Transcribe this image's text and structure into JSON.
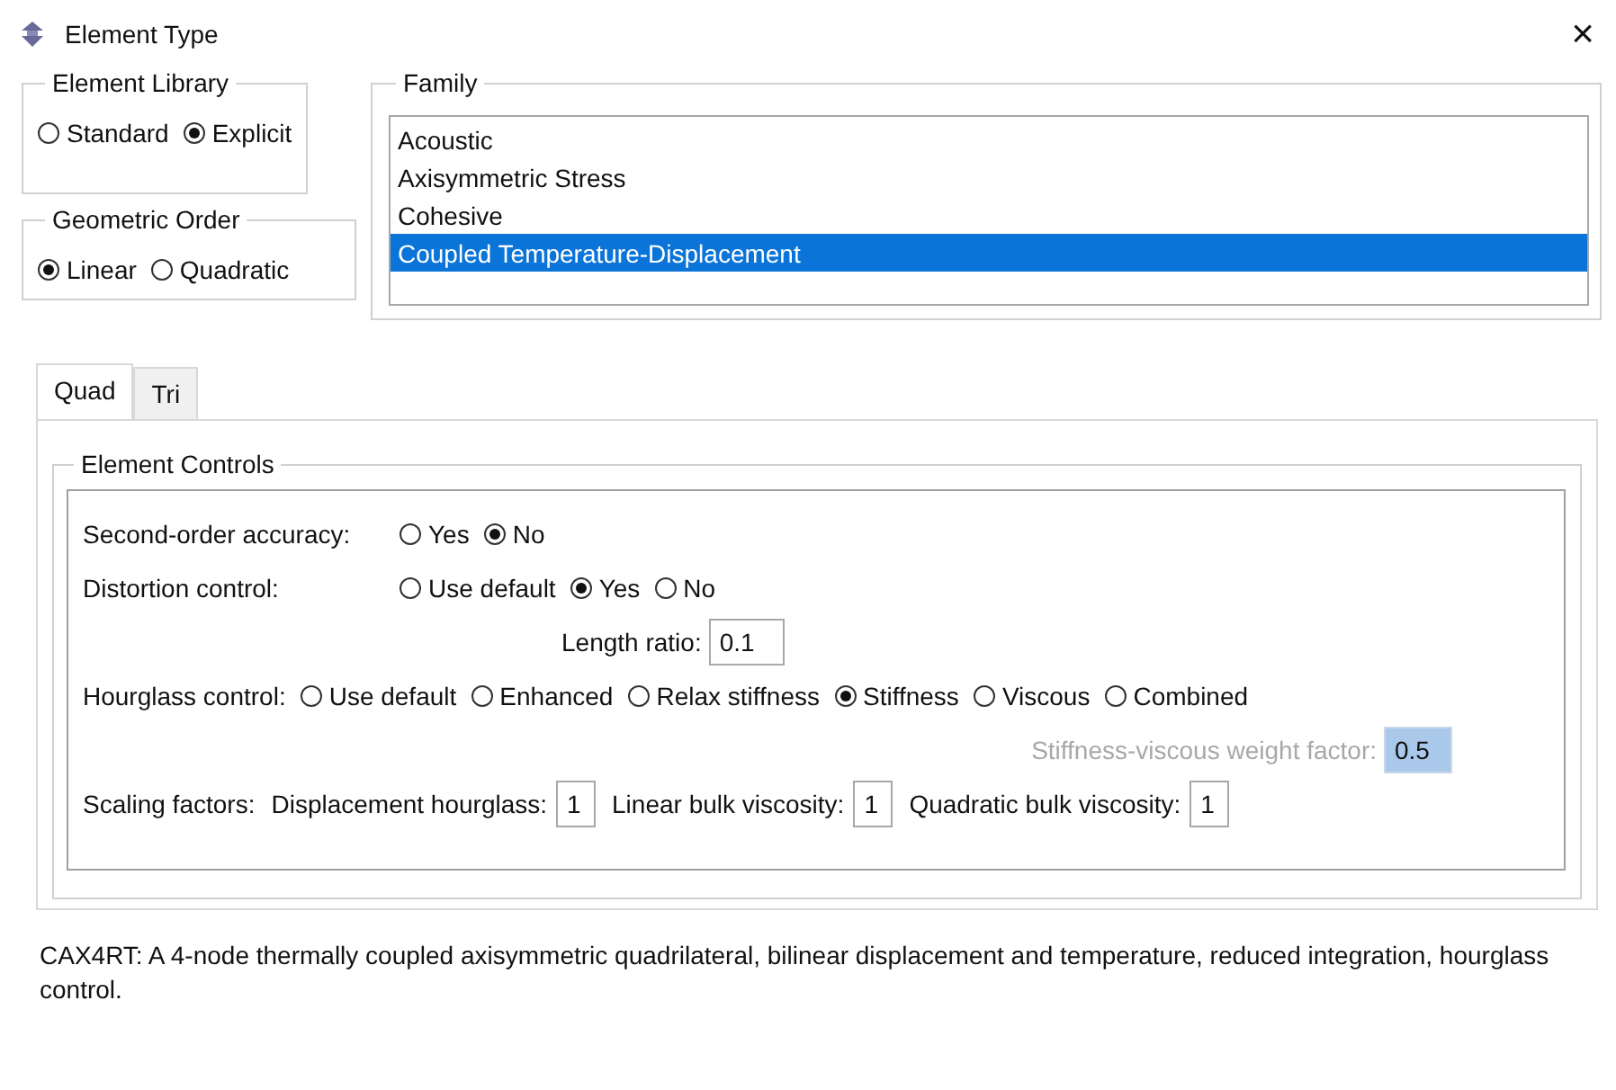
{
  "window": {
    "title": "Element Type",
    "close": "×"
  },
  "element_library": {
    "title": "Element Library",
    "options": [
      {
        "label": "Standard",
        "selected": false
      },
      {
        "label": "Explicit",
        "selected": true
      }
    ]
  },
  "geometric_order": {
    "title": "Geometric Order",
    "options": [
      {
        "label": "Linear",
        "selected": true
      },
      {
        "label": "Quadratic",
        "selected": false
      }
    ]
  },
  "family": {
    "title": "Family",
    "items": [
      {
        "label": "Acoustic",
        "selected": false
      },
      {
        "label": "Axisymmetric Stress",
        "selected": false
      },
      {
        "label": "Cohesive",
        "selected": false
      },
      {
        "label": "Coupled Temperature-Displacement",
        "selected": true
      }
    ]
  },
  "tabs": [
    {
      "label": "Quad",
      "selected": true
    },
    {
      "label": "Tri",
      "selected": false
    }
  ],
  "element_controls": {
    "title": "Element Controls",
    "rows": [
      {
        "kind": "radio",
        "label": "Second-order accuracy:",
        "options": [
          {
            "label": "Yes",
            "selected": false
          },
          {
            "label": "No",
            "selected": true
          }
        ]
      },
      {
        "kind": "radio",
        "label": "Distortion control:",
        "options": [
          {
            "label": "Use default",
            "selected": false
          },
          {
            "label": "Yes",
            "selected": true
          },
          {
            "label": "No",
            "selected": false
          }
        ]
      },
      {
        "kind": "field",
        "label": "Length ratio:",
        "value": "0.1",
        "disabled": false
      },
      {
        "kind": "radio",
        "label": "Hourglass control:",
        "options": [
          {
            "label": "Use default",
            "selected": false
          },
          {
            "label": "Enhanced",
            "selected": false
          },
          {
            "label": "Relax stiffness",
            "selected": false
          },
          {
            "label": "Stiffness",
            "selected": true
          },
          {
            "label": "Viscous",
            "selected": false
          },
          {
            "label": "Combined",
            "selected": false
          }
        ]
      },
      {
        "kind": "field",
        "label": "Stiffness-viscous weight factor:",
        "value": "0.5",
        "disabled": true
      },
      {
        "kind": "fields",
        "label": "Scaling factors:",
        "fields": [
          {
            "label": "Displacement hourglass:",
            "value": "1"
          },
          {
            "label": "Linear bulk viscosity:",
            "value": "1"
          },
          {
            "label": "Quadratic bulk viscosity:",
            "value": "1"
          }
        ]
      }
    ]
  },
  "description": "CAX4RT:  A 4-node thermally coupled axisymmetric quadrilateral, bilinear displacement and temperature, reduced integration, hourglass control."
}
